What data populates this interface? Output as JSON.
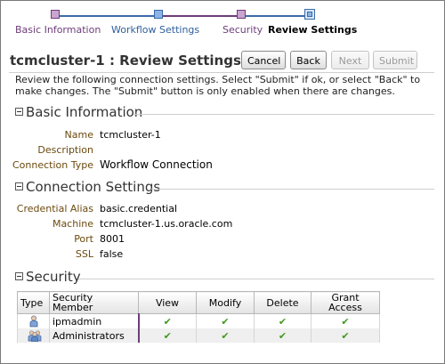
{
  "train": {
    "stops": [
      {
        "label": "Basic Information",
        "state": "visited"
      },
      {
        "label": "Workflow Settings",
        "state": "next"
      },
      {
        "label": "Security",
        "state": "visited"
      },
      {
        "label": "Review Settings",
        "state": "current"
      }
    ]
  },
  "header": {
    "title": "tcmcluster-1 : Review Settings",
    "buttons": {
      "cancel": "Cancel",
      "back": "Back",
      "next": "Next",
      "submit": "Submit"
    }
  },
  "instructions": "Review the following connection settings. Select \"Submit\" if ok, or select \"Back\" to make changes. The \"Submit\" button is only enabled when there are changes.",
  "basic_information": {
    "heading": "Basic Information",
    "fields": [
      {
        "label": "Name",
        "value": "tcmcluster-1"
      },
      {
        "label": "Description",
        "value": ""
      },
      {
        "label": "Connection Type",
        "value": "Workflow Connection"
      }
    ]
  },
  "connection_settings": {
    "heading": "Connection Settings",
    "fields": [
      {
        "label": "Credential Alias",
        "value": "basic.credential"
      },
      {
        "label": "Machine",
        "value": "tcmcluster-1.us.oracle.com"
      },
      {
        "label": "Port",
        "value": "8001"
      },
      {
        "label": "SSL",
        "value": "false"
      }
    ]
  },
  "security": {
    "heading": "Security",
    "columns": [
      "Type",
      "Security Member",
      "View",
      "Modify",
      "Delete",
      "Grant Access"
    ],
    "rows": [
      {
        "type_icon": "user-icon",
        "member": "ipmadmin",
        "view": "✔",
        "modify": "✔",
        "delete": "✔",
        "grant": "✔"
      },
      {
        "type_icon": "group-icon",
        "member": "Administrators",
        "view": "✔",
        "modify": "✔",
        "delete": "✔",
        "grant": "✔"
      }
    ]
  },
  "colors": {
    "visited": "#6e3d7a",
    "next": "#2e5f9e",
    "label": "#6b4a0e",
    "check": "#3f9a1c"
  }
}
